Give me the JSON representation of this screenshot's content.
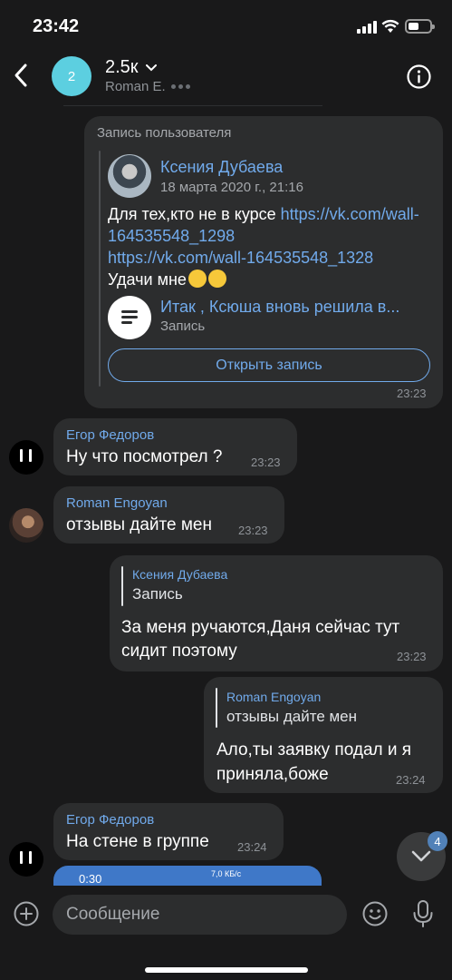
{
  "status_bar": {
    "time": "23:42"
  },
  "header": {
    "avatar_text": "2",
    "title": "2.5к",
    "subtitle": "Roman E."
  },
  "messages": {
    "shared_post": {
      "caption": "Запись пользователя",
      "author": "Ксения Дубаева",
      "date": "18 марта 2020 г., 21:16",
      "text_prefix": "Для тех,кто не в курсе ",
      "link1": "https://vk.com/wall-164535548_1298",
      "link2": "https://vk.com/wall-164535548_1328",
      "text_suffix": "Удачи мне",
      "nested_title": "Итак , Ксюша вновь решила в...",
      "nested_subtitle": "Запись",
      "open_button": "Открыть запись",
      "time": "23:23"
    },
    "msg1": {
      "sender": "Егор Федоров",
      "text": "Ну что посмотрел ?",
      "time": "23:23"
    },
    "msg2": {
      "sender": "Roman Engoyan",
      "text": "отзывы дайте мен",
      "time": "23:23"
    },
    "msg3": {
      "reply_name": "Ксения Дубаева",
      "reply_text": "Запись",
      "line1": "За меня ручаются,Даня сейчас тут",
      "line2": "сидит поэтому",
      "time": "23:23"
    },
    "msg4": {
      "reply_name": "Roman Engoyan",
      "reply_text": "отзывы дайте мен",
      "line1": "Ало,ты заявку подал и я",
      "line2": "приняла,боже",
      "time": "23:24"
    },
    "msg5": {
      "sender": "Егор Федоров",
      "text": "На стене в группе",
      "time": "23:24"
    },
    "preview": {
      "time": "0:30",
      "speed": "7,0 КБ/с"
    }
  },
  "unread_count": "4",
  "composer": {
    "placeholder": "Сообщение"
  }
}
